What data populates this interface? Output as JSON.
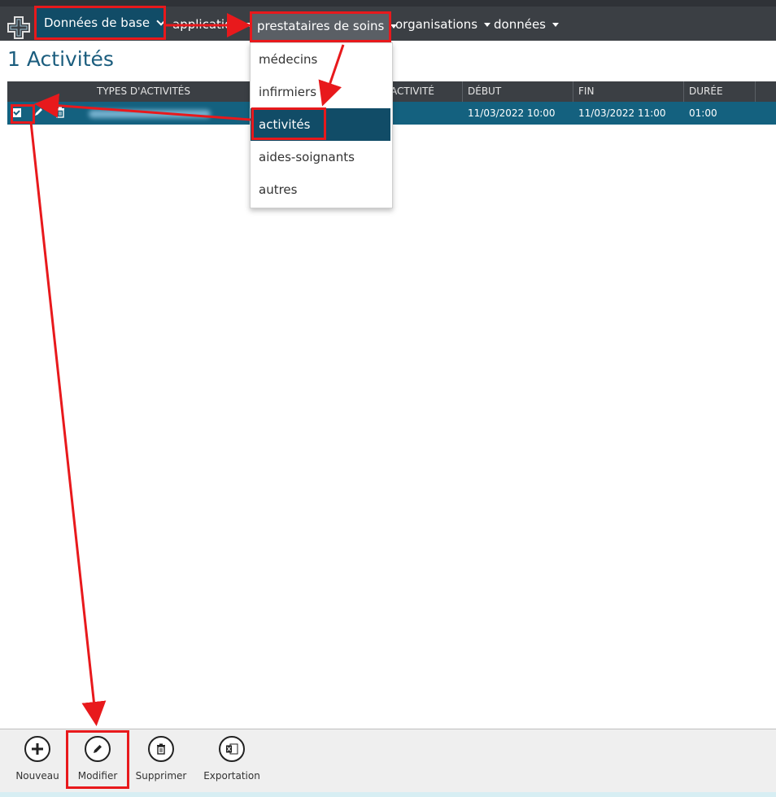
{
  "nav": {
    "base": "Données de base",
    "application": "application",
    "prestataires": "prestataires de soins",
    "organisations": "organisations",
    "donnees": "données"
  },
  "page": {
    "title": "1 Activités"
  },
  "table": {
    "headers": [
      "TYPES D'ACTIVITÉS PRESTATAIRE",
      "ACTIVITÉ",
      "DÉBUT",
      "FIN",
      "DURÉE"
    ],
    "row": {
      "debut": "11/03/2022 10:00",
      "fin": "11/03/2022 11:00",
      "duree": "01:00"
    }
  },
  "dropdown": {
    "items": [
      "médecins",
      "infirmiers",
      "activités",
      "aides-soignants",
      "autres"
    ]
  },
  "toolbar": {
    "nouveau": "Nouveau",
    "modifier": "Modifier",
    "supprimer": "Supprimer",
    "exportation": "Exportation"
  },
  "colors": {
    "accent": "#114c67",
    "bar": "#3b3f44",
    "annotation": "#e8191c"
  }
}
